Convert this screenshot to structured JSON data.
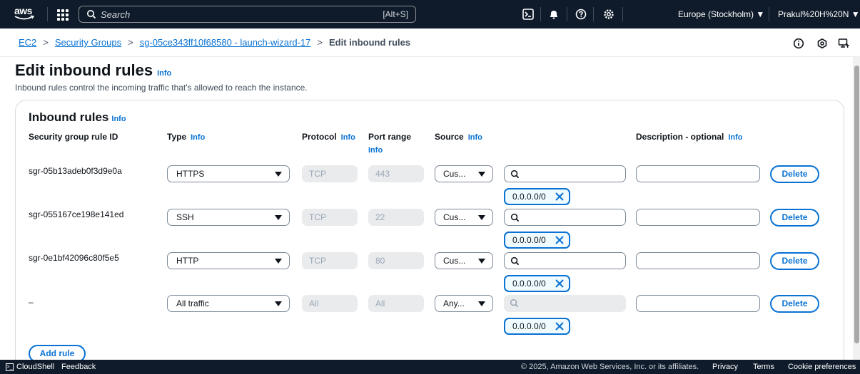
{
  "nav": {
    "logo": "aws",
    "search_placeholder": "Search",
    "search_shortcut": "[Alt+S]",
    "region": "Europe (Stockholm) ▼",
    "user": "Prakul%20H%20N ▼"
  },
  "breadcrumb": {
    "items": [
      "EC2",
      "Security Groups",
      "sg-05ce343ff10f68580 - launch-wizard-17"
    ],
    "current": "Edit inbound rules"
  },
  "page": {
    "title": "Edit inbound rules",
    "info": "Info",
    "description": "Inbound rules control the incoming traffic that's allowed to reach the instance."
  },
  "panel": {
    "title": "Inbound rules",
    "info": "Info",
    "columns": {
      "rule_id": "Security group rule ID",
      "type": "Type",
      "protocol": "Protocol",
      "port_range": "Port range",
      "source": "Source",
      "description": "Description - optional"
    },
    "rules": [
      {
        "id": "sgr-05b13adeb0f3d9e0a",
        "type": "HTTPS",
        "protocol": "TCP",
        "port": "443",
        "source": "Cus...",
        "cidr": "0.0.0.0/0"
      },
      {
        "id": "sgr-055167ce198e141ed",
        "type": "SSH",
        "protocol": "TCP",
        "port": "22",
        "source": "Cus...",
        "cidr": "0.0.0.0/0"
      },
      {
        "id": "sgr-0e1bf42096c80f5e5",
        "type": "HTTP",
        "protocol": "TCP",
        "port": "80",
        "source": "Cus...",
        "cidr": "0.0.0.0/0"
      },
      {
        "id": "–",
        "type": "All traffic",
        "protocol": "All",
        "port": "All",
        "source": "Any...",
        "cidr": "0.0.0.0/0"
      }
    ],
    "delete_label": "Delete",
    "add_rule_label": "Add rule"
  },
  "footer": {
    "cloudshell": "CloudShell",
    "feedback": "Feedback",
    "copyright": "© 2025, Amazon Web Services, Inc. or its affiliates.",
    "privacy": "Privacy",
    "terms": "Terms",
    "cookie": "Cookie preferences"
  },
  "colors": {
    "nav_bg": "#0f1b2a",
    "link": "#0972d3",
    "accent_smile": "#ff9900"
  }
}
